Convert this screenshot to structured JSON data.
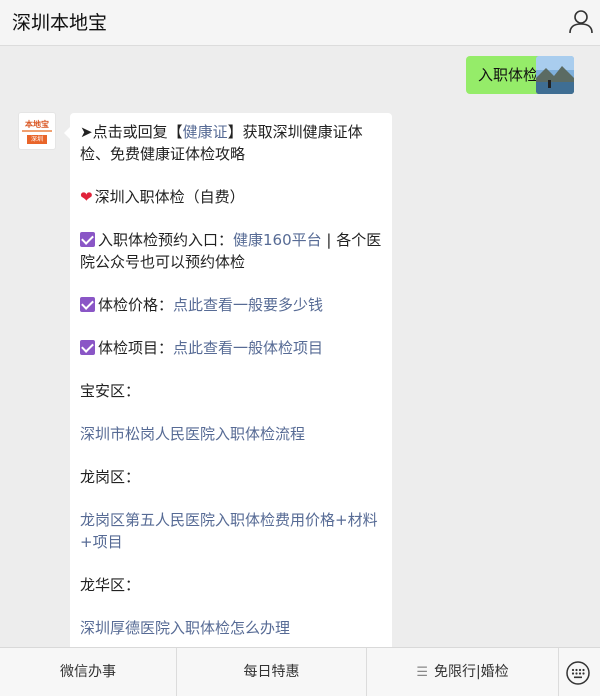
{
  "header": {
    "title": "深圳本地宝",
    "user_icon": "user-icon"
  },
  "outgoing": {
    "text": "入职体检",
    "avatar_icon": "landscape-photo-avatar"
  },
  "bot": {
    "avatar_top": "本地宝",
    "avatar_bottom": "深圳",
    "avatar_icon": "bendibao-logo",
    "p1": {
      "arrow": "➤",
      "text1": "点击或回复【",
      "link": "健康证",
      "text2": "】获取深圳健康证体检、免费健康证体检攻略"
    },
    "p2": {
      "text": "深圳入职体检（自费）",
      "icon": "heart-icon"
    },
    "p3": {
      "label": "入职体检预约入口：",
      "link": "健康160平台",
      "text": " | 各个医院公众号也可以预约体检"
    },
    "p4": {
      "label": "体检价格：",
      "link": "点此查看一般要多少钱"
    },
    "p5": {
      "label": "体检项目：",
      "link": "点此查看一般体检项目"
    },
    "p6": {
      "text": "宝安区："
    },
    "p7": {
      "link": "深圳市松岗人民医院入职体检流程"
    },
    "p8": {
      "text": "龙岗区："
    },
    "p9": {
      "link": "龙岗区第五人民医院入职体检费用价格+材料+项目"
    },
    "p10": {
      "text": "龙华区："
    },
    "p11": {
      "link": "深圳厚德医院入职体检怎么办理"
    }
  },
  "menu": {
    "items": [
      "微信办事",
      "每日特惠",
      "免限行|婚检"
    ],
    "menu3_icon": "hamburger-icon",
    "keyboard_icon": "keyboard-icon"
  },
  "colors": {
    "bubble_out": "#95ec69",
    "link": "#576b95",
    "check": "#8a56c6"
  }
}
